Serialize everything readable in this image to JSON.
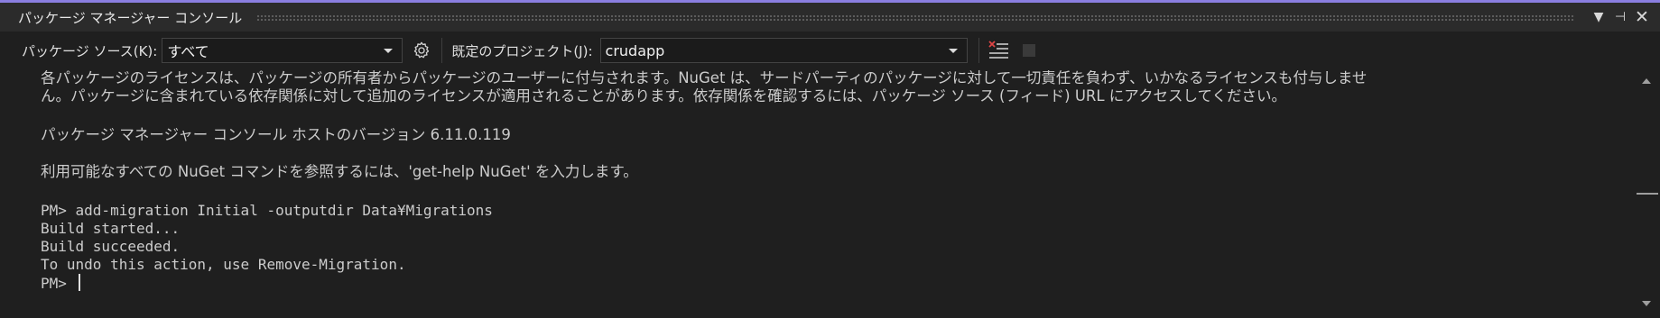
{
  "window": {
    "title": "パッケージ マネージャー コンソール",
    "buttons": {
      "dropdown": "▼",
      "pin": "⊣",
      "close": "✕"
    }
  },
  "toolbar": {
    "package_source_label": "パッケージ ソース(K):",
    "package_source_value": "すべて",
    "default_project_label": "既定のプロジェクト(J):",
    "default_project_value": "crudapp",
    "icons": [
      "gear-icon",
      "clear-console-icon",
      "stop-icon"
    ]
  },
  "console": {
    "lines": [
      "各パッケージのライセンスは、パッケージの所有者からパッケージのユーザーに付与されます。NuGet は、サードパーティのパッケージに対して一切責任を負わず、いかなるライセンスも付与しませ",
      "ん。パッケージに含まれている依存関係に対して追加のライセンスが適用されることがあります。依存関係を確認するには、パッケージ ソース (フィード) URL にアクセスしてください。",
      "パッケージ マネージャー コンソール ホストのバージョン 6.11.0.119",
      "利用可能なすべての NuGet コマンドを参照するには、'get-help NuGet' を入力します。",
      "PM> add-migration Initial -outputdir Data¥Migrations",
      "Build started...",
      "Build succeeded.",
      "To undo this action, use Remove-Migration.",
      "PM> "
    ]
  },
  "colors": {
    "background": "#1f1f1f",
    "titlebar": "#2b2b2b",
    "accent": "#8a7ee0",
    "text": "#cccccc",
    "clear_icon_red": "#e04545"
  }
}
